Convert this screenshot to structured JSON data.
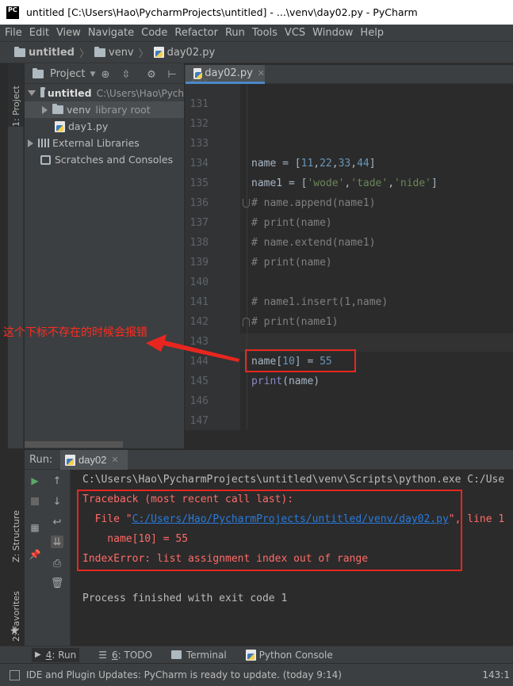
{
  "window": {
    "title": "untitled [C:\\Users\\Hao\\PycharmProjects\\untitled] - ...\\venv\\day02.py - PyCharm",
    "logo": "PC"
  },
  "menu": [
    "File",
    "Edit",
    "View",
    "Navigate",
    "Code",
    "Refactor",
    "Run",
    "Tools",
    "VCS",
    "Window",
    "Help"
  ],
  "breadcrumb": [
    "untitled",
    "venv",
    "day02.py"
  ],
  "left_stripe": {
    "project": "1: Project",
    "structure": "Z: Structure",
    "favorites": "2: Favorites"
  },
  "project": {
    "header": "Project",
    "items": [
      {
        "label": "untitled",
        "detail": "C:\\Users\\Hao\\Pych"
      },
      {
        "label": "venv",
        "detail": "library root"
      },
      {
        "label": "day1.py",
        "detail": ""
      },
      {
        "label": "External Libraries",
        "detail": ""
      },
      {
        "label": "Scratches and Consoles",
        "detail": ""
      }
    ]
  },
  "editor": {
    "tab": "day02.py",
    "top_line": "130",
    "lines": [
      {
        "n": "131"
      },
      {
        "n": "132"
      },
      {
        "n": "133"
      },
      {
        "n": "134",
        "parts": [
          [
            "name = [",
            ""
          ],
          [
            "11",
            "num"
          ],
          [
            ",",
            ""
          ],
          [
            "22",
            "num"
          ],
          [
            ",",
            ""
          ],
          [
            "33",
            "num"
          ],
          [
            ",",
            ""
          ],
          [
            "44",
            "num"
          ],
          [
            "]",
            ""
          ]
        ]
      },
      {
        "n": "135",
        "parts": [
          [
            "name1 = [",
            ""
          ],
          [
            "'wode'",
            "str"
          ],
          [
            ",",
            ""
          ],
          [
            "'tade'",
            "str"
          ],
          [
            ",",
            ""
          ],
          [
            "'nide'",
            "str"
          ],
          [
            "]",
            ""
          ]
        ]
      },
      {
        "n": "136",
        "parts": [
          [
            "# name.append(name1)",
            "cmt"
          ]
        ]
      },
      {
        "n": "137",
        "parts": [
          [
            "# print(name)",
            "cmt"
          ]
        ]
      },
      {
        "n": "138",
        "parts": [
          [
            "# name.extend(name1)",
            "cmt"
          ]
        ]
      },
      {
        "n": "139",
        "parts": [
          [
            "# print(name)",
            "cmt"
          ]
        ]
      },
      {
        "n": "140"
      },
      {
        "n": "141",
        "parts": [
          [
            "# name1.insert(1,name)",
            "cmt"
          ]
        ]
      },
      {
        "n": "142",
        "parts": [
          [
            "# print(name1)",
            "cmt"
          ]
        ]
      },
      {
        "n": "143"
      },
      {
        "n": "144",
        "parts": [
          [
            "name[",
            ""
          ],
          [
            "10",
            "num"
          ],
          [
            "] = ",
            ""
          ],
          [
            "55",
            "num"
          ]
        ]
      },
      {
        "n": "145",
        "parts": [
          [
            "print",
            "bi"
          ],
          [
            "(name)",
            ""
          ]
        ]
      },
      {
        "n": "146"
      },
      {
        "n": "147"
      }
    ]
  },
  "annotation": "这个下标不存在的时候会报错",
  "run": {
    "label": "Run:",
    "tab": "day02",
    "console": [
      {
        "t": "C:\\Users\\Hao\\PycharmProjects\\untitled\\venv\\Scripts\\python.exe C:/Use",
        "c": "#bbbbbb"
      },
      {
        "t": "Traceback (most recent call last):",
        "c": "#ff6b68"
      },
      {
        "t": "  File \"",
        "link": "C:/Users/Hao/PycharmProjects/untitled/venv/day02.py",
        "tail": "\", line 1",
        "c": "#ff6b68"
      },
      {
        "t": "    name[10] = 55",
        "c": "#ff6b68"
      },
      {
        "t": "IndexError: list assignment index out of range",
        "c": "#ff6b68"
      },
      {
        "t": "",
        "c": "#bbbbbb"
      },
      {
        "t": "Process finished with exit code 1",
        "c": "#bbbbbb"
      }
    ]
  },
  "bottom_tabs": [
    {
      "num": "4",
      "label": ": Run"
    },
    {
      "num": "6",
      "label": ": TODO"
    },
    {
      "num": "",
      "label": "Terminal"
    },
    {
      "num": "",
      "label": "Python Console"
    }
  ],
  "status": {
    "message": "IDE and Plugin Updates: PyCharm is ready to update. (today 9:14)",
    "position": "143:1"
  },
  "colors": {
    "accent": "#4a88c7",
    "annotation": "#ff2b1f",
    "error": "#ff6b68",
    "link": "#287bde"
  }
}
